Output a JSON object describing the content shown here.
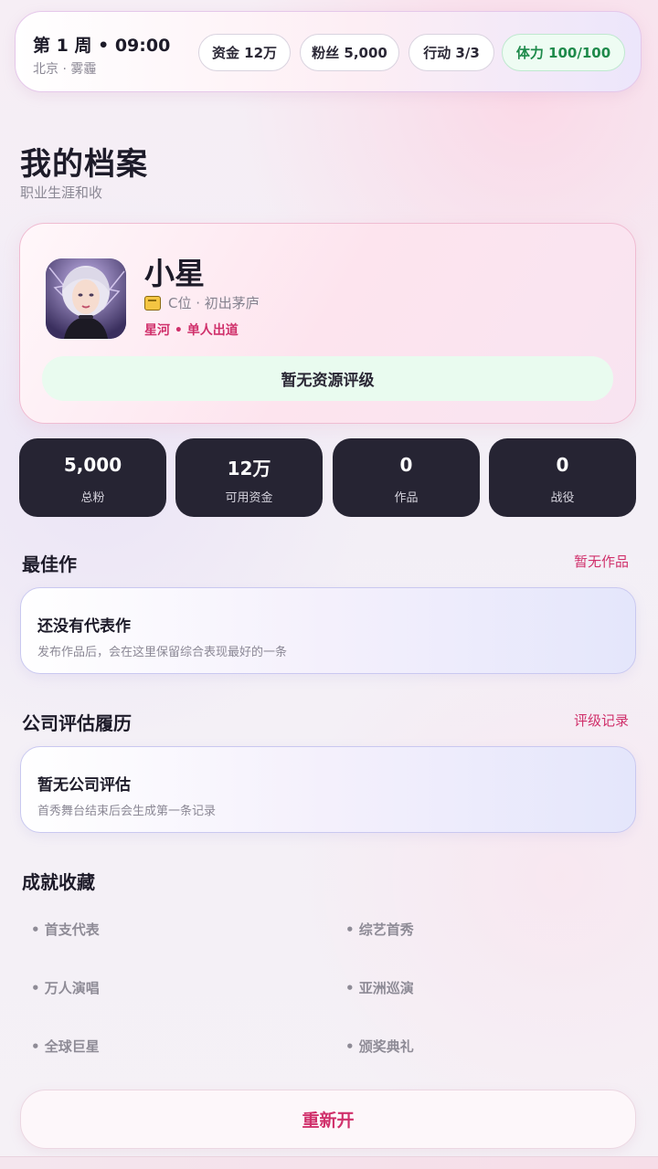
{
  "status": {
    "time": "第 1 周 • 09:00",
    "location": "北京 · 雾霾",
    "funds": "资金 12万",
    "fans": "粉丝 5,000",
    "action": "行动 3/3",
    "stamina": "体力 100/100"
  },
  "header": {
    "title": "我的档案",
    "subtitle": "职业生涯和收"
  },
  "profile": {
    "name": "小星",
    "rank": "C位 · 初出茅庐",
    "debut": "星河 • 单人出道",
    "resource_label": "暂无资源评级"
  },
  "stats": [
    {
      "value": "5,000",
      "label": "总粉"
    },
    {
      "value": "12万",
      "label": "可用资金"
    },
    {
      "value": "0",
      "label": "作品"
    },
    {
      "value": "0",
      "label": "战役"
    }
  ],
  "best_work": {
    "title": "最佳作",
    "link": "暂无作品",
    "card_title": "还没有代表作",
    "card_desc": "发布作品后，会在这里保留综合表现最好的一条"
  },
  "evaluation": {
    "title": "公司评估履历",
    "link": "评级记录",
    "card_title": "暂无公司评估",
    "card_desc": "首秀舞台结束后会生成第一条记录"
  },
  "achievements": {
    "title": "成就收藏",
    "items": [
      "• 首支代表",
      "• 综艺首秀",
      "• 万人演唱",
      "• 亚洲巡演",
      "• 全球巨星",
      "• 颁奖典礼"
    ]
  },
  "restart_label": "重新开",
  "colors": {
    "accent": "#d0306b",
    "stamina": "#1e8a4b",
    "tile": "#262433"
  }
}
